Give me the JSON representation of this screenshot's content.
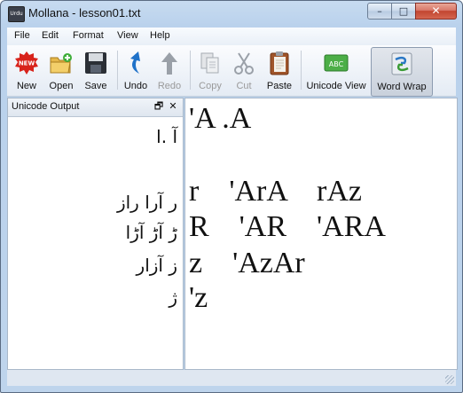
{
  "window": {
    "title": "Mollana - lesson01.txt",
    "app_icon_text": "Urdu",
    "caption_buttons": {
      "minimize": "–",
      "maximize": "□",
      "close": "✕"
    }
  },
  "menu": [
    "File",
    "Edit",
    "Format",
    "View",
    "Help"
  ],
  "toolbar": [
    {
      "label": "New",
      "icon": "new-icon",
      "enabled": true
    },
    {
      "label": "Open",
      "icon": "open-folder-icon",
      "enabled": true
    },
    {
      "label": "Save",
      "icon": "floppy-disk-icon",
      "enabled": true
    },
    {
      "label": "Undo",
      "icon": "undo-arrow-icon",
      "enabled": true
    },
    {
      "label": "Redo",
      "icon": "redo-arrow-icon",
      "enabled": false
    },
    {
      "label": "Copy",
      "icon": "copy-icon",
      "enabled": false
    },
    {
      "label": "Cut",
      "icon": "scissors-icon",
      "enabled": false
    },
    {
      "label": "Paste",
      "icon": "clipboard-paste-icon",
      "enabled": true
    },
    {
      "label": "Unicode View",
      "icon": "abc-icon",
      "enabled": true
    },
    {
      "label": "Word Wrap",
      "icon": "word-wrap-icon",
      "enabled": true,
      "active": true
    }
  ],
  "dock": {
    "title": "Unicode Output",
    "float_glyph": "🗗",
    "close_glyph": "✕",
    "lines": [
      "آ .ا",
      "",
      "ر   آرا   راز",
      "ڑ   آڑ   آڑا",
      "ز   آزار",
      "ژ"
    ]
  },
  "editor": {
    "lines": [
      "'A .A",
      "",
      "r    'ArA    rAz",
      "R    'AR    'ARA",
      "z    'AzAr",
      "'z"
    ]
  },
  "colors": {
    "title_bar": "#b9d1ec",
    "close_button": "#c24530",
    "disabled_text": "#9a9a9a",
    "undo_blue": "#1f72c9"
  }
}
